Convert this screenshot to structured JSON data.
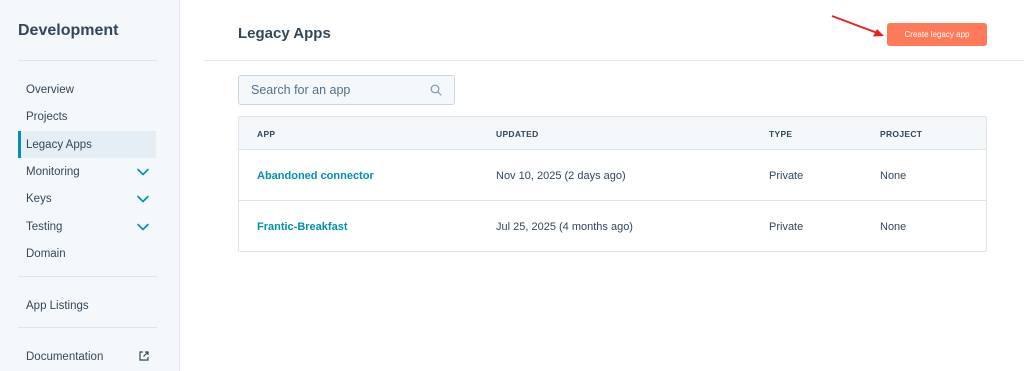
{
  "sidebar": {
    "title": "Development",
    "items": [
      {
        "label": "Overview"
      },
      {
        "label": "Projects"
      },
      {
        "label": "Legacy Apps"
      },
      {
        "label": "Monitoring"
      },
      {
        "label": "Keys"
      },
      {
        "label": "Testing"
      },
      {
        "label": "Domain"
      },
      {
        "label": "App Listings"
      },
      {
        "label": "Documentation"
      }
    ],
    "active_item": "Legacy Apps",
    "expandable_items": [
      "Monitoring",
      "Keys",
      "Testing"
    ]
  },
  "header": {
    "title": "Legacy Apps",
    "create_button_label": "Create legacy app",
    "accent_color": "#ff7a59",
    "annotation_arrow_color": "#e8231f"
  },
  "search": {
    "placeholder": "Search for an app",
    "value": ""
  },
  "table": {
    "columns": [
      "APP",
      "UPDATED",
      "TYPE",
      "PROJECT"
    ],
    "rows": [
      {
        "app": "Abandoned connector",
        "updated": "Nov 10, 2025 (2 days ago)",
        "type": "Private",
        "project": "None"
      },
      {
        "app": "Frantic-Breakfast",
        "updated": "Jul 25, 2025 (4 months ago)",
        "type": "Private",
        "project": "None"
      }
    ],
    "link_color": "#0091ae"
  },
  "icons": {
    "search": "search-icon",
    "chevron": "chevron-down-icon",
    "external": "external-link-icon"
  }
}
